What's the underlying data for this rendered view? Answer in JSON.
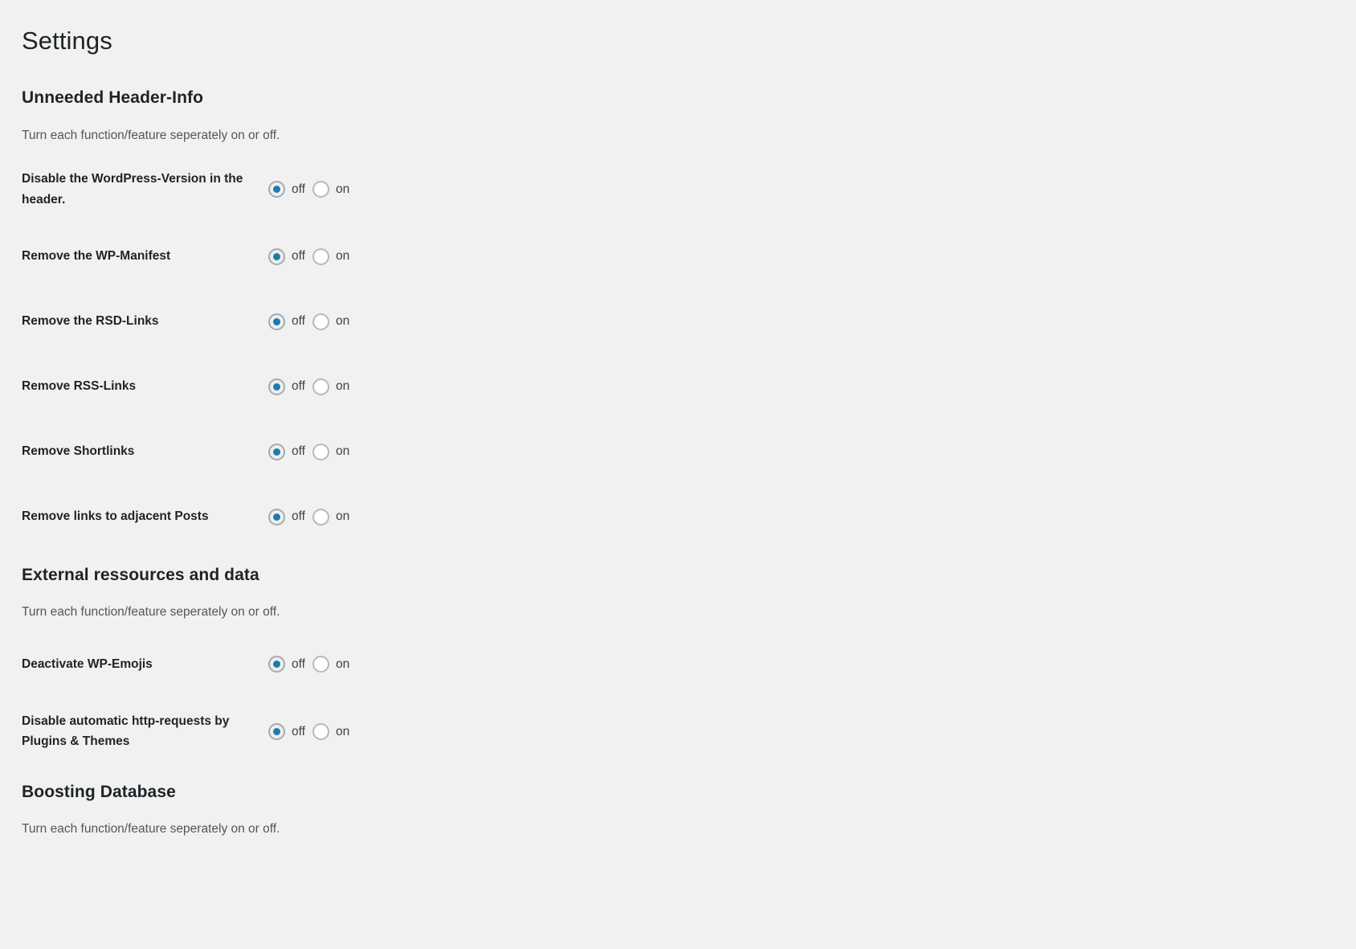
{
  "page": {
    "title": "Settings"
  },
  "radio_labels": {
    "off": "off",
    "on": "on"
  },
  "colors": {
    "background": "#f1f1f1",
    "accent": "#1f7ba8",
    "heading_text": "#1d2327",
    "muted_text": "#50575e",
    "radio_border": "#b4b9be"
  },
  "sections": [
    {
      "title": "Unneeded Header-Info",
      "description": "Turn each function/feature seperately on or off.",
      "rows": [
        {
          "label": "Disable the WordPress-Version in the header.",
          "value": "off"
        },
        {
          "label": "Remove the WP-Manifest",
          "value": "off"
        },
        {
          "label": "Remove the RSD-Links",
          "value": "off"
        },
        {
          "label": "Remove RSS-Links",
          "value": "off"
        },
        {
          "label": "Remove Shortlinks",
          "value": "off"
        },
        {
          "label": "Remove links to adjacent Posts",
          "value": "off"
        }
      ]
    },
    {
      "title": "External ressources and data",
      "description": "Turn each function/feature seperately on or off.",
      "rows": [
        {
          "label": "Deactivate WP-Emojis",
          "value": "off"
        },
        {
          "label": "Disable automatic http-requests by Plugins & Themes",
          "value": "off"
        }
      ]
    },
    {
      "title": "Boosting Database",
      "description": "Turn each function/feature seperately on or off.",
      "rows": []
    }
  ]
}
